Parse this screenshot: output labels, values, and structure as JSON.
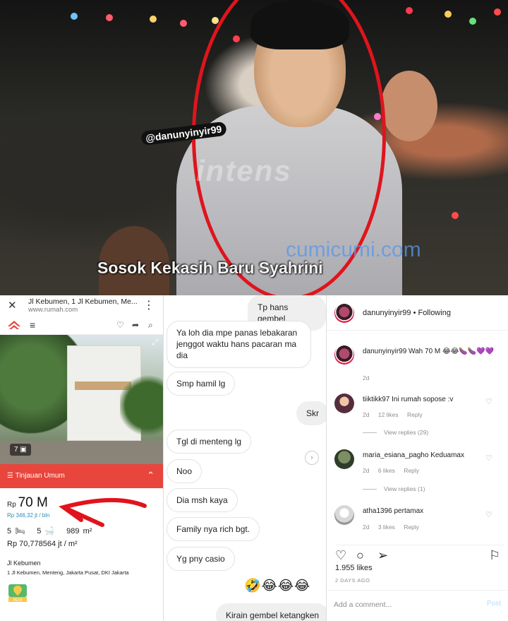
{
  "photo": {
    "caption": "Sosok Kekasih Baru Syahrini",
    "watermark_intens": "intens",
    "watermark_cumi": "cumicumi.com"
  },
  "listing": {
    "page_title": "Jl Kebumen, 1 Jl Kebumen, Me...",
    "url": "www.rumah.com",
    "photo_count": "7",
    "section_title": "Tinjauan Umum",
    "price_prefix": "Rp",
    "price": "70 M",
    "price_per_month": "Rp 346,32 jt / bln",
    "bedrooms": "5",
    "bathrooms": "5",
    "area": "989 m²",
    "price_per_m2": "Rp 70,778564 jt / m²",
    "address_title": "Jl Kebumen",
    "address": "1 Jl Kebumen, Menteng, Jakarta Pusat, DKI Jakarta",
    "map_label": "PETA",
    "ig_tag": "@danunyinyir99",
    "colors": {
      "brand": "#e8453c",
      "accent_link": "#2a8fb5"
    }
  },
  "chat": {
    "messages": [
      {
        "text": "Tp hans gembel",
        "side": "sent"
      },
      {
        "text": "Ya loh dia mpe panas lebakaran jenggot waktu hans pacaran ma dia",
        "side": "received"
      },
      {
        "text": "Smp hamil lg",
        "side": "received"
      },
      {
        "text": "Skr",
        "side": "sent"
      },
      {
        "text": "Tgl di menteng lg",
        "side": "received"
      },
      {
        "text": "Noo",
        "side": "received"
      },
      {
        "text": "Dia msh kaya",
        "side": "received"
      },
      {
        "text": "Family nya rich bgt.",
        "side": "received"
      },
      {
        "text": "Yg pny casio",
        "side": "received"
      },
      {
        "text": "Kirain gembel ketangken",
        "side": "sent"
      }
    ],
    "emoji_row": "🤣😂😂😂"
  },
  "instagram": {
    "header_user": "danunyinyir99",
    "header_follow": "• Following",
    "caption_user": "danunyinyir99",
    "caption_text": "Wah 70 M 😂😂🍆🍆💜💜",
    "caption_age": "2d",
    "comments": [
      {
        "user": "tiiktikk97",
        "text": "Ini rumah sopose :v",
        "age": "2d",
        "likes": "12 likes",
        "reply": "Reply",
        "view_replies": "View replies (29)"
      },
      {
        "user": "maria_esiana_pagho",
        "text": "Keduamax",
        "age": "2d",
        "likes": "6 likes",
        "reply": "Reply",
        "view_replies": "View replies (1)"
      },
      {
        "user": "atha1396",
        "text": "pertamax",
        "age": "2d",
        "likes": "3 likes",
        "reply": "Reply",
        "view_replies": ""
      }
    ],
    "likes_count": "1.955 likes",
    "posted_ago": "2 DAYS AGO",
    "comment_placeholder": "Add a comment...",
    "post_label": "Post",
    "colors": {
      "post_disabled": "#b3dbff",
      "meta_gray": "#8e8e8e"
    }
  }
}
